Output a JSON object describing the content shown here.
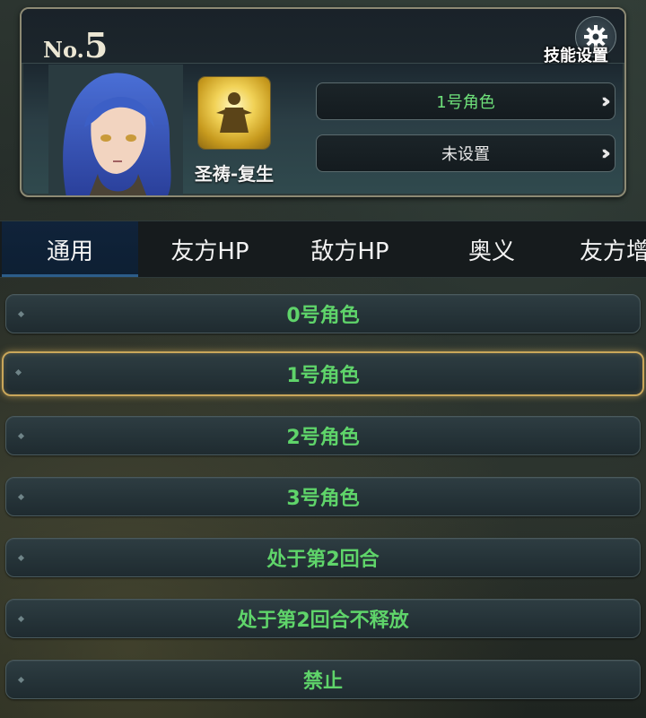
{
  "card": {
    "no_prefix": "No.",
    "no_value": "5",
    "skill_name": "圣祷-复生",
    "slots": [
      {
        "label": "1号角色",
        "color": "#6ee07a"
      },
      {
        "label": "未设置",
        "color": "#e8e8e8"
      }
    ],
    "settings_label": "技能设置",
    "settings_icon": "gear-icon"
  },
  "tabs": [
    {
      "label": "通用",
      "active": true
    },
    {
      "label": "友方HP",
      "active": false
    },
    {
      "label": "敌方HP",
      "active": false
    },
    {
      "label": "奥义",
      "active": false
    },
    {
      "label": "友方增",
      "active": false
    }
  ],
  "options": [
    {
      "label": "0号角色",
      "selected": false
    },
    {
      "label": "1号角色",
      "selected": true
    },
    {
      "label": "2号角色",
      "selected": false
    },
    {
      "label": "3号角色",
      "selected": false
    },
    {
      "label": "处于第2回合",
      "selected": false
    },
    {
      "label": "处于第2回合不释放",
      "selected": false
    },
    {
      "label": "禁止",
      "selected": false
    }
  ],
  "colors": {
    "option_text": "#5fd46a",
    "selected_border": "#c9a65a",
    "active_tab_bg": "#10233a"
  }
}
